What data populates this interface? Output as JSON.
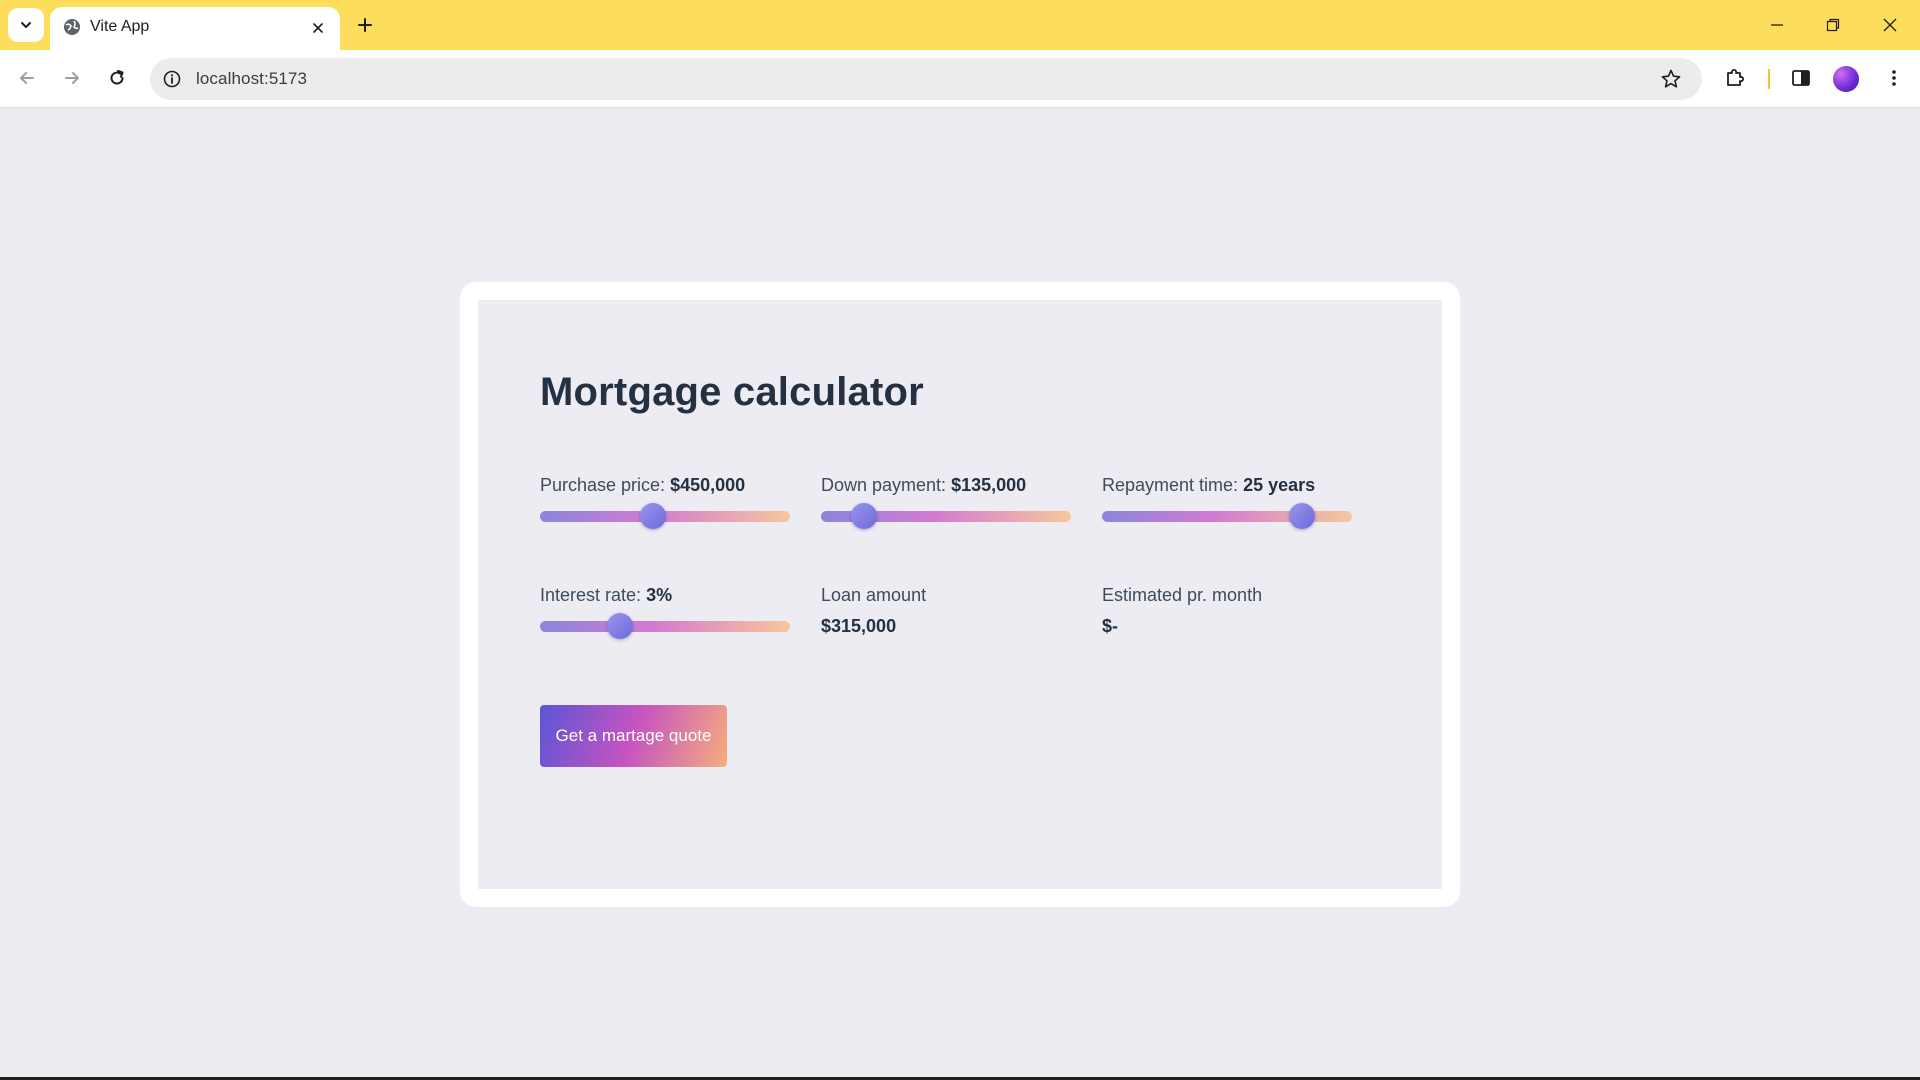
{
  "browser": {
    "tab_title": "Vite App",
    "url": "localhost:5173",
    "theme_color": "#fddd5c"
  },
  "icons": {
    "tab_search": "chevron-down-icon",
    "favicon": "globe-icon",
    "tab_close": "close-icon",
    "new_tab": "plus-icon",
    "back": "arrow-left-icon",
    "forward": "arrow-right-icon",
    "reload": "reload-icon",
    "site_info": "info-icon",
    "bookmark": "star-icon",
    "extensions": "puzzle-icon",
    "side_panel": "side-panel-icon",
    "menu": "kebab-menu-icon"
  },
  "calculator": {
    "title": "Mortgage calculator",
    "purchase_price": {
      "label": "Purchase price: ",
      "value": "$450,000",
      "level": 0.45
    },
    "down_payment": {
      "label": "Down payment: ",
      "value": "$135,000",
      "level": 0.17
    },
    "repayment_time": {
      "label": "Repayment time: ",
      "value": "25 years",
      "level": 0.8
    },
    "interest_rate": {
      "label": "Interest rate: ",
      "value": "3%",
      "level": 0.32
    },
    "loan_amount": {
      "label": "Loan amount",
      "value": "$315,000"
    },
    "estimated_month": {
      "label": "Estimated pr. month",
      "value": "$-"
    },
    "quote_button": "Get a martage quote",
    "colors": {
      "gradient_start": "#5c55d6",
      "gradient_mid": "#c654c0",
      "gradient_end": "#f6ad7e",
      "page_background": "#edecf3",
      "text": "#243142"
    }
  }
}
